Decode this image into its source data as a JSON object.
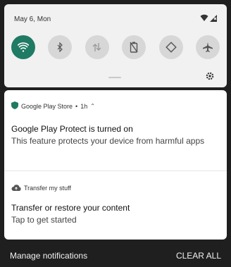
{
  "quick_settings": {
    "date": "May 6, Mon",
    "tiles": [
      {
        "name": "wifi-icon",
        "active": true
      },
      {
        "name": "bluetooth-icon",
        "active": false
      },
      {
        "name": "mobile-data-icon",
        "active": false
      },
      {
        "name": "battery-saver-icon",
        "active": false
      },
      {
        "name": "auto-rotate-icon",
        "active": false
      },
      {
        "name": "airplane-mode-icon",
        "active": false
      }
    ],
    "accent_color": "#1f7b63",
    "tile_inactive_color": "#d7d7d7"
  },
  "notifications": [
    {
      "app_name": "Google Play Store",
      "separator": "•",
      "time": "1h",
      "title": "Google Play Protect is turned on",
      "body": "This feature protects your device from harmful apps",
      "icon": "shield-icon",
      "icon_color": "#1f7b63"
    },
    {
      "app_name": "Transfer my stuff",
      "title": "Transfer or restore your content",
      "body": "Tap to get started",
      "icon": "cloud-upload-icon",
      "icon_color": "#555555"
    }
  ],
  "footer": {
    "manage_label": "Manage notifications",
    "clear_label": "CLEAR ALL"
  }
}
